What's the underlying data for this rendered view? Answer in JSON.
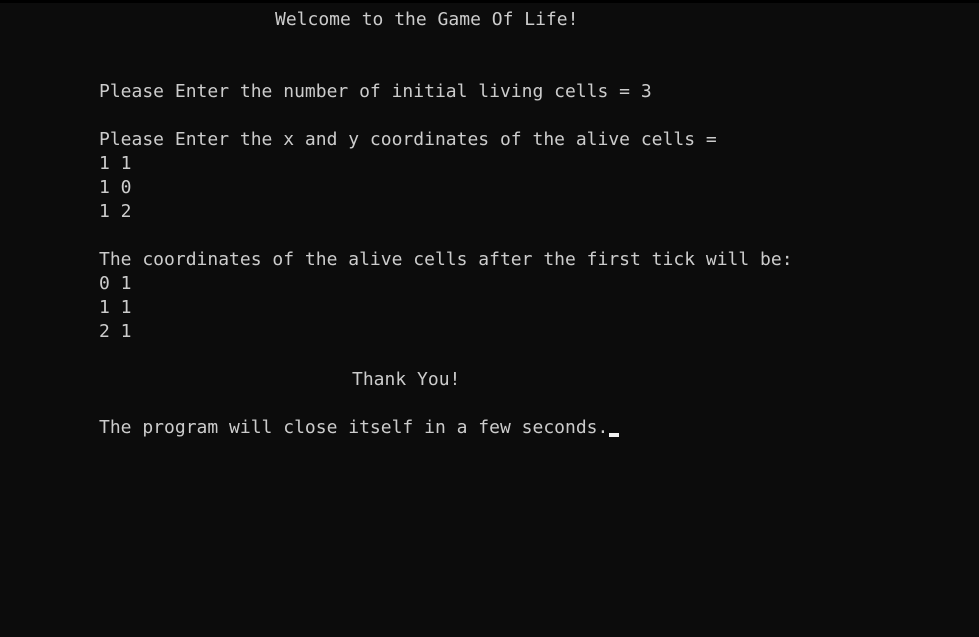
{
  "console": {
    "title": "Welcome to the Game Of Life!",
    "prompt_count": "Please Enter the number of initial living cells = 3",
    "prompt_coords": "Please Enter the x and y coordinates of the alive cells =",
    "input_coords": [
      "1 1",
      "1 0",
      "1 2"
    ],
    "result_heading": "The coordinates of the alive cells after the first tick will be:",
    "result_coords": [
      "0 1",
      "1 1",
      "2 1"
    ],
    "thank_you": "Thank You!",
    "closing": "The program will close itself in a few seconds."
  }
}
